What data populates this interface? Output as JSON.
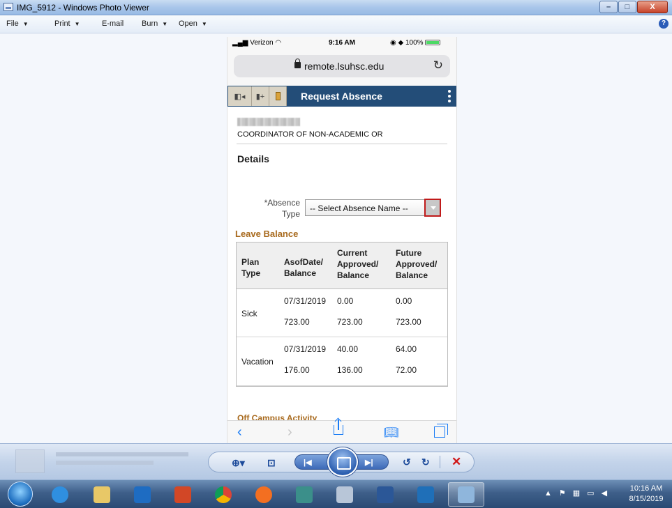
{
  "window": {
    "title": "IMG_5912 - Windows Photo Viewer",
    "minimize": "–",
    "maximize": "□",
    "close": "X"
  },
  "menu": {
    "items": [
      {
        "label": "File"
      },
      {
        "label": "Print"
      },
      {
        "label": "E-mail"
      },
      {
        "label": "Burn"
      },
      {
        "label": "Open"
      }
    ],
    "help": "?"
  },
  "phone": {
    "status": {
      "carrier": "Verizon",
      "time": "9:16 AM",
      "battery": "100%"
    },
    "url": "remote.lsuhsc.edu",
    "app_title": "Request Absence",
    "job_title": "COORDINATOR OF NON-ACADEMIC OR",
    "details_heading": "Details",
    "absence_type": {
      "label_line1": "*Absence",
      "label_line2": "Type",
      "selected": "-- Select Absence Name --"
    },
    "leave_balance_heading": "Leave Balance",
    "table": {
      "headers": {
        "plan_type": [
          "Plan",
          "Type"
        ],
        "asof": [
          "AsofDate/",
          "Balance"
        ],
        "current": [
          "Current",
          "Approved/",
          "Balance"
        ],
        "future": [
          "Future",
          "Approved/",
          "Balance"
        ]
      },
      "rows": [
        {
          "plan": "Sick",
          "asof_date": "07/31/2019",
          "current_top": "0.00",
          "future_top": "0.00",
          "balance": "723.00",
          "current_bal": "723.00",
          "future_bal": "723.00"
        },
        {
          "plan": "Vacation",
          "asof_date": "07/31/2019",
          "current_top": "40.00",
          "future_top": "64.00",
          "balance": "176.00",
          "current_bal": "136.00",
          "future_bal": "72.00"
        }
      ]
    },
    "next_section": "Off Campus Activity"
  },
  "taskbar": {
    "time": "10:16 AM",
    "date": "8/15/2019"
  }
}
